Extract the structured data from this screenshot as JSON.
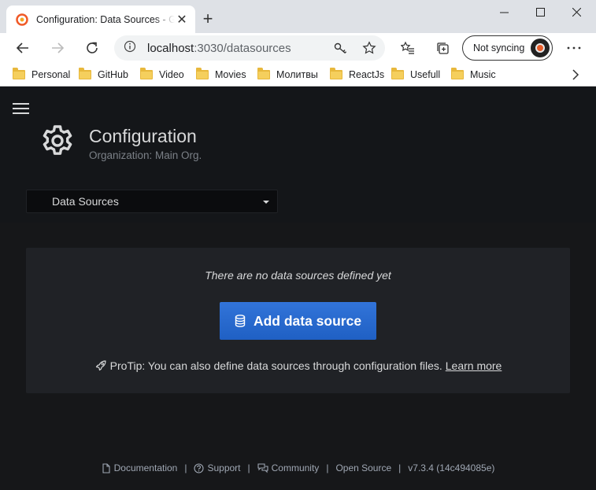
{
  "browser": {
    "tab_title": "Configuration: Data Sources - Grafana",
    "url_host": "localhost",
    "url_path": ":3030/datasources",
    "sync_label": "Not syncing",
    "bookmarks": [
      "Personal",
      "GitHub",
      "Video",
      "Movies",
      "Молитвы",
      "ReactJs",
      "Usefull",
      "Music"
    ]
  },
  "header": {
    "title": "Configuration",
    "subtitle": "Organization: Main Org.",
    "select_value": "Data Sources"
  },
  "main": {
    "empty_message": "There are no data sources defined yet",
    "add_button": "Add data source",
    "protip": "ProTip: You can also define data sources through configuration files.",
    "learn_more": "Learn more"
  },
  "footer": {
    "documentation": "Documentation",
    "support": "Support",
    "community": "Community",
    "open_source": "Open Source",
    "version": "v7.3.4 (14c494085e)"
  },
  "colors": {
    "primary_button": "#3274d9",
    "background": "#161719",
    "card": "#202226"
  }
}
